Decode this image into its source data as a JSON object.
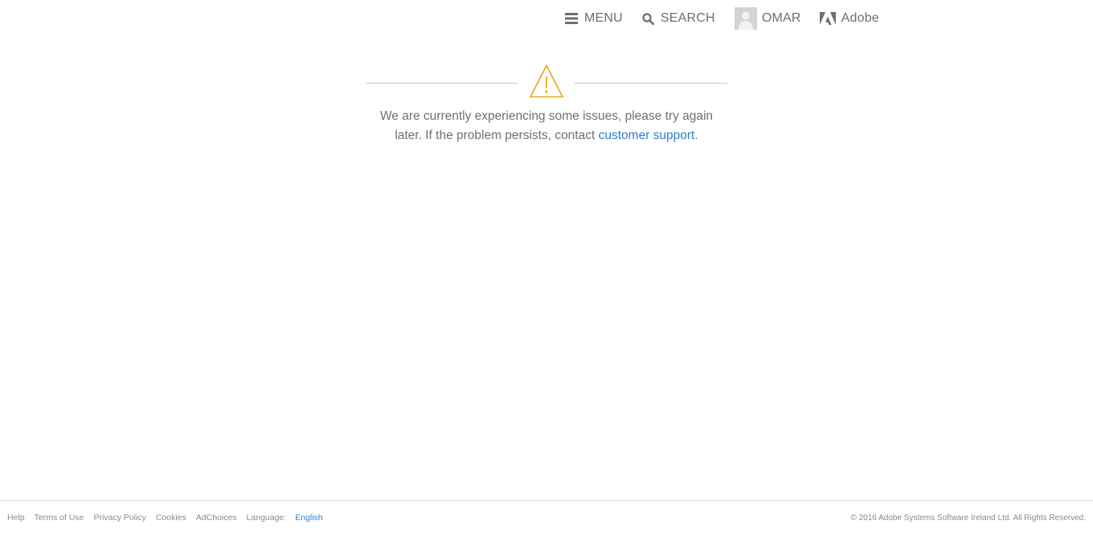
{
  "header": {
    "menu_label": "MENU",
    "search_label": "SEARCH",
    "user_name": "OMAR",
    "brand_label": "Adobe",
    "icons": [
      "hamburger-menu-icon",
      "search-icon",
      "user-avatar-icon",
      "adobe-logo-icon"
    ]
  },
  "alert": {
    "icon": "warning-triangle-icon",
    "icon_color": "#e6a817",
    "message_before": "We are currently experiencing some issues, please try again later. If the problem persists, contact",
    "link_text": "customer support",
    "message_after": ".",
    "link_color": "#2d7fcf"
  },
  "footer": {
    "links": [
      "Help",
      "Terms of Use",
      "Privacy Policy",
      "Cookies",
      "AdChoices"
    ],
    "language_label": "Language:",
    "language_value": "English",
    "copyright": "© 2016 Adobe Systems Software Ireland Ltd. All Rights Reserved."
  }
}
